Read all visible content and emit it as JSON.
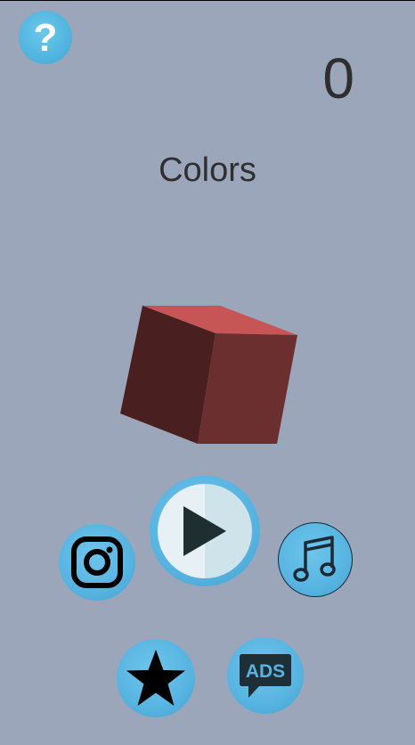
{
  "help": {
    "glyph": "?"
  },
  "score": {
    "value": "0"
  },
  "mode": {
    "title": "Colors"
  },
  "buttons": {
    "play_icon": "play-icon",
    "instagram_icon": "instagram-icon",
    "music_icon": "music-note-icon",
    "rate_icon": "star-icon",
    "ads_label": "ADS"
  },
  "colors": {
    "background": "#9ba6bb",
    "button_blue": "#57b4e0",
    "cube_top": "#c65656",
    "cube_left": "#4a1f1f",
    "cube_right": "#6b2f2f"
  }
}
